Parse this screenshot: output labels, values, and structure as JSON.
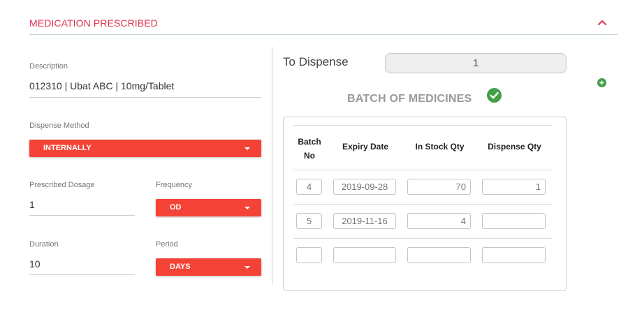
{
  "section": {
    "title": "MEDICATION PRESCRIBED"
  },
  "form": {
    "description_label": "Description",
    "description_value": "012310 | Ubat ABC | 10mg/Tablet",
    "dispense_method_label": "Dispense Method",
    "dispense_method_value": "INTERNALLY",
    "prescribed_dosage_label": "Prescribed Dosage",
    "prescribed_dosage_value": "1",
    "frequency_label": "Frequency",
    "frequency_value": "OD",
    "duration_label": "Duration",
    "duration_value": "10",
    "period_label": "Period",
    "period_value": "DAYS"
  },
  "dispense": {
    "label": "To Dispense",
    "value": "1"
  },
  "batch": {
    "title": "BATCH OF MEDICINES",
    "headers": {
      "batch_no_1": "Batch",
      "batch_no_2": "No",
      "expiry": "Expiry Date",
      "stock": "In Stock Qty",
      "dispense": "Dispense Qty"
    },
    "rows": [
      {
        "batch_no": "4",
        "expiry": "2019-09-28",
        "stock": "70",
        "dispense": "1"
      },
      {
        "batch_no": "5",
        "expiry": "2019-11-16",
        "stock": "4",
        "dispense": ""
      },
      {
        "batch_no": "",
        "expiry": "",
        "stock": "",
        "dispense": ""
      }
    ]
  },
  "colors": {
    "accent_red": "#f44336",
    "title_red": "#e0324e",
    "success_green": "#43a047"
  },
  "icons": {
    "collapse": "chevron-up-icon",
    "add": "plus-circle-icon",
    "verified": "check-circle-icon"
  }
}
